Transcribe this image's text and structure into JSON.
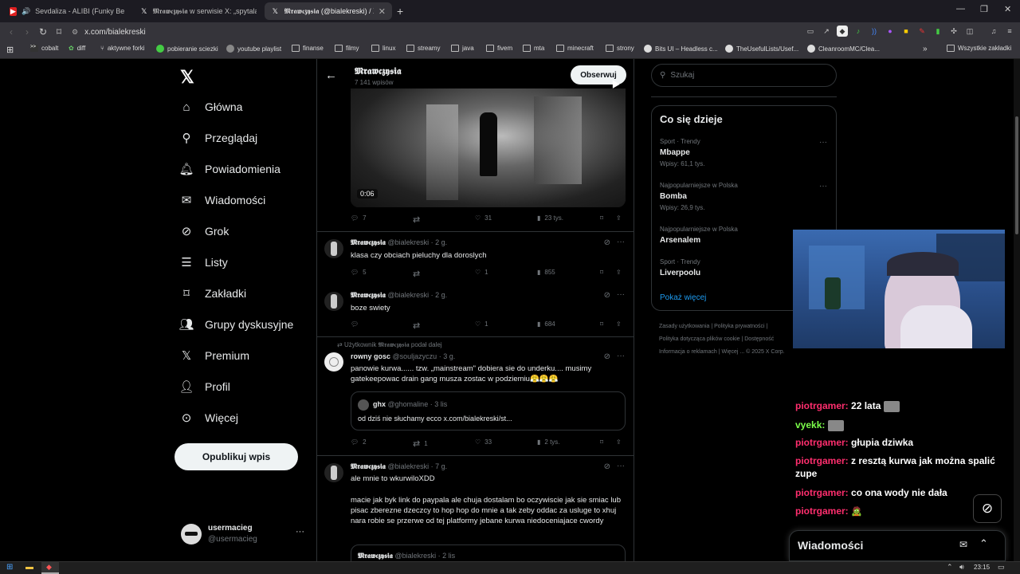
{
  "browser": {
    "tabs": [
      {
        "title": "Sevdaliza - ALIBI (Funky Beatz Bo",
        "icon": "youtube-icon"
      },
      {
        "title": "𝕸𝖗𝖆𝖜𝖈𝖟𝖞𝖘𝖎𝖆 w serwisie X: „spytalam ci",
        "icon": "x-icon"
      },
      {
        "title": "𝕸𝖗𝖆𝖜𝖈𝖟𝖞𝖘𝖎𝖆 (@bialekreski) / X",
        "icon": "x-icon"
      }
    ],
    "url": "x.com/bialekreski",
    "bookmarks": [
      "cobalt",
      "diff",
      "aktywne forki",
      "pobieranie sciezki",
      "youtube playlist",
      "finanse",
      "filmy",
      "linux",
      "streamy",
      "java",
      "fivem",
      "mta",
      "minecraft",
      "strony",
      "Bits UI – Headless c...",
      "TheUsefulLists/Usef...",
      "CleanroomMC/Clea..."
    ],
    "bookmarks_all": "Wszystkie zakładki"
  },
  "nav": {
    "items": [
      "Główna",
      "Przeglądaj",
      "Powiadomienia",
      "Wiadomości",
      "Grok",
      "Listy",
      "Zakładki",
      "Grupy dyskusyjne",
      "Premium",
      "Profil",
      "Więcej"
    ],
    "post_button": "Opublikuj wpis",
    "account_name": "usermacieg",
    "account_handle": "@usermacieg"
  },
  "profile": {
    "name": "𝕸𝖗𝖆𝖜𝖈𝖟𝖞𝖘𝖎𝖆",
    "posts_count": "7 141 wpisów",
    "follow_label": "Obserwuj"
  },
  "video": {
    "duration": "0:06"
  },
  "tweets": [
    {
      "replies": "7",
      "reposts": "",
      "likes": "31",
      "views": "23 tys."
    },
    {
      "name": "𝕸𝖗𝖆𝖜𝖈𝖟𝖞𝖘𝖎𝖆",
      "handle": "@bialekreski",
      "time": "· 2 g.",
      "text": "klasa czy obciach pieluchy dla doroslych",
      "replies": "5",
      "reposts": "",
      "likes": "1",
      "views": "855"
    },
    {
      "name": "𝕸𝖗𝖆𝖜𝖈𝖟𝖞𝖘𝖎𝖆",
      "handle": "@bialekreski",
      "time": "· 2 g.",
      "text": "boze swiety",
      "replies": "",
      "reposts": "",
      "likes": "1",
      "views": "684"
    },
    {
      "repost_note": "Użytkownik 𝕸𝖗𝖆𝖜𝖈𝖟𝖞𝖘𝖎𝖆 podał dalej",
      "name": "rowny gosc",
      "handle": "@souljazyczu",
      "time": "· 3 g.",
      "text": "panowie kurwa...... tzw. „mainstream\" dobiera sie do underku.... musimy gatekeepowac drain gang musza zostac w podziemiu😤😤😤",
      "quote_name": "ghx",
      "quote_handle": "@ghomaline",
      "quote_time": "· 3 lis",
      "quote_text": "od dziś nie słuchamy ecco x.com/bialekreski/st...",
      "replies": "2",
      "reposts": "1",
      "likes": "33",
      "views": "2 tys."
    },
    {
      "name": "𝕸𝖗𝖆𝖜𝖈𝖟𝖞𝖘𝖎𝖆",
      "handle": "@bialekreski",
      "time": "· 7 g.",
      "text": "ale mnie to wkurwiloXDD",
      "text2": "macie jak byk link do paypala ale chuja dostalam bo oczywiscie jak sie smiac lub pisac zberezne dzeczcy to hop hop do mnie a tak zeby oddac za usluge to xhuj nara robie se przerwe od tej platformy jebane kurwa niedoceniajace cwordy",
      "quote_name": "𝕸𝖗𝖆𝖜𝖈𝖟𝖞𝖘𝖎𝖆",
      "quote_handle": "@bialekreski",
      "quote_time": "· 2 lis"
    }
  ],
  "right": {
    "search_placeholder": "Szukaj",
    "trends_title": "Co się dzieje",
    "trends": [
      {
        "meta": "Sport · Trendy",
        "name": "Mbappe",
        "count": "Wpisy: 61,1 tys."
      },
      {
        "meta": "Najpopularniejsze w Polska",
        "name": "Bomba",
        "count": "Wpisy: 26,9 tys."
      },
      {
        "meta": "Najpopularniejsze w Polska",
        "name": "Arsenalem",
        "count": ""
      },
      {
        "meta": "Sport · Trendy",
        "name": "Liverpoolu",
        "count": ""
      }
    ],
    "show_more": "Pokaż więcej",
    "footer1": "Zasady użytkowania   |   Polityka prywatności   |",
    "footer2": "Polityka dotycząca plików cookie   |   Dostępność",
    "footer3": "Informacja o reklamach   |   Więcej ...   © 2025 X Corp."
  },
  "chat": [
    {
      "user": "piotrgamer:",
      "msg": "22 lata",
      "emote": true,
      "color": "#ff2e6e"
    },
    {
      "user": "vyekk:",
      "msg": "",
      "emote": true,
      "color": "#7cff4a"
    },
    {
      "user": "piotrgamer:",
      "msg": "głupia dziwka",
      "emote": false,
      "color": "#ff2e6e"
    },
    {
      "user": "piotrgamer:",
      "msg": "z resztą kurwa jak można spalić zupe",
      "emote": false,
      "color": "#ff2e6e"
    },
    {
      "user": "piotrgamer:",
      "msg": "co ona wody nie dała",
      "emote": false,
      "color": "#ff2e6e"
    },
    {
      "user": "piotrgamer:",
      "msg": "🧟",
      "emote": false,
      "color": "#ff2e6e"
    }
  ],
  "messages_label": "Wiadomości",
  "clock": "23:15"
}
